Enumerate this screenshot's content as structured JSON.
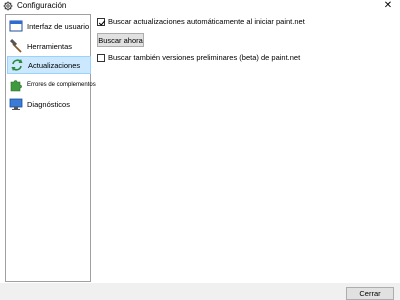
{
  "window": {
    "title": "Configuración",
    "close_symbol": "✕"
  },
  "sidebar": {
    "items": [
      {
        "label": "Interfaz de usuario",
        "icon": "window-icon",
        "selected": false
      },
      {
        "label": "Herramientas",
        "icon": "hammer-icon",
        "selected": false
      },
      {
        "label": "Actualizaciones",
        "icon": "refresh-icon",
        "selected": true
      },
      {
        "label": "Errores de complementos",
        "icon": "puzzle-icon",
        "selected": false
      },
      {
        "label": "Diagnósticos",
        "icon": "monitor-icon",
        "selected": false
      }
    ]
  },
  "updates": {
    "auto_check_label": "Buscar actualizaciones automáticamente al iniciar paint.net",
    "auto_check_checked": true,
    "check_now_label": "Buscar ahora",
    "beta_label": "Buscar también versiones preliminares (beta) de paint.net",
    "beta_checked": false
  },
  "footer": {
    "close_label": "Cerrar"
  },
  "colors": {
    "selection_bg": "#cce8ff",
    "selection_border": "#99d1ff",
    "accent": "#0078d7"
  }
}
